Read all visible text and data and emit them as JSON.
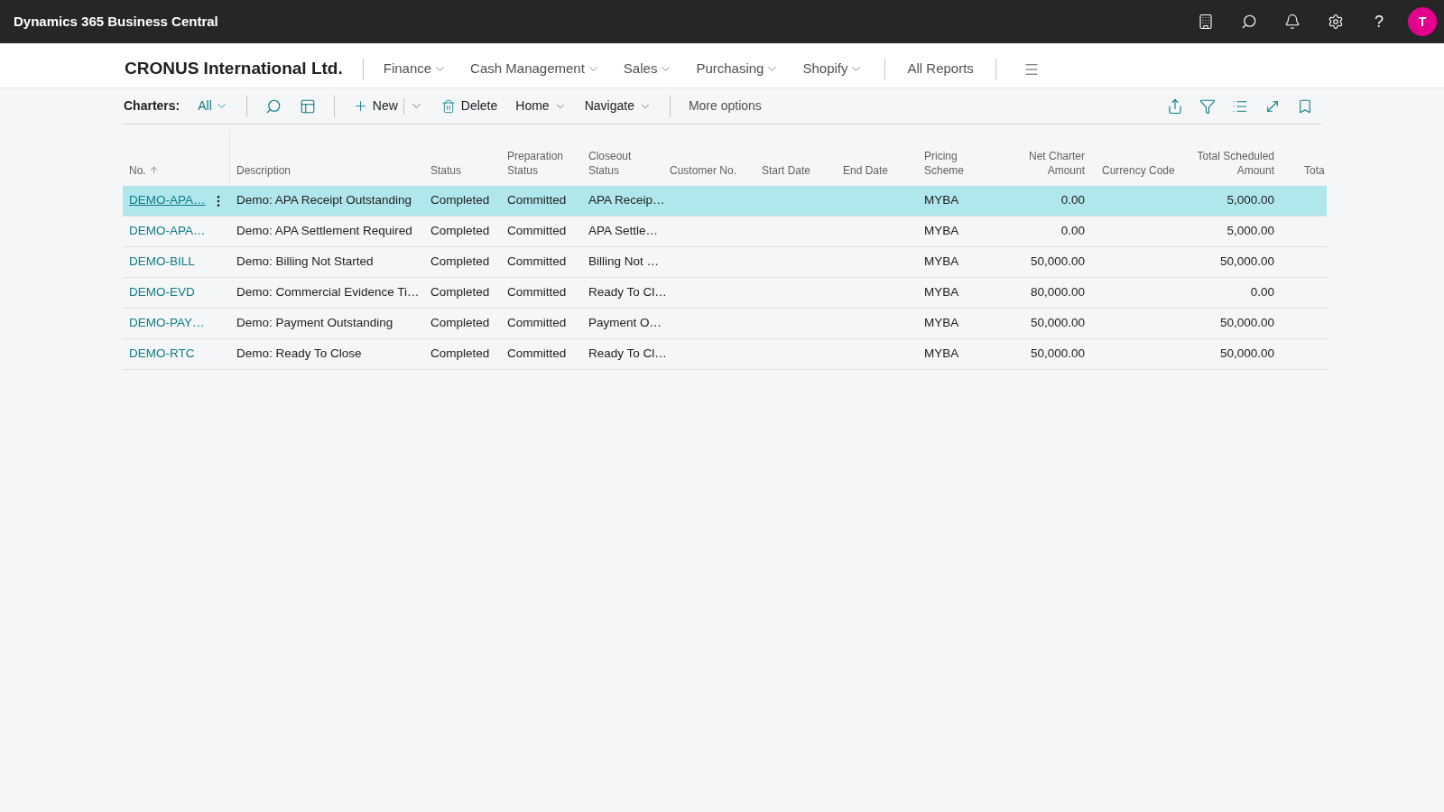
{
  "top_bar": {
    "title": "Dynamics 365 Business Central",
    "help_label": "?",
    "avatar_initial": "T"
  },
  "nav": {
    "company": "CRONUS International Ltd.",
    "menus": [
      {
        "label": "Finance"
      },
      {
        "label": "Cash Management"
      },
      {
        "label": "Sales"
      },
      {
        "label": "Purchasing"
      },
      {
        "label": "Shopify"
      }
    ],
    "reports_link": "All Reports"
  },
  "action_bar": {
    "page_label": "Charters:",
    "view": "All",
    "actions": [
      {
        "kind": "new",
        "label": "New"
      },
      {
        "kind": "delete",
        "label": "Delete"
      },
      {
        "kind": "menu",
        "label": "Home"
      },
      {
        "kind": "menu",
        "label": "Navigate"
      },
      {
        "kind": "more",
        "label": "More options"
      }
    ]
  },
  "table": {
    "columns": [
      {
        "label": "No.",
        "kind": "link",
        "sorted_ascending": true
      },
      {
        "label": "Description",
        "kind": "text",
        "sorted_ascending": false
      },
      {
        "label": "Status",
        "kind": "text",
        "sorted_ascending": false
      },
      {
        "label": "Preparation Status",
        "kind": "text",
        "sorted_ascending": false
      },
      {
        "label": "Closeout Status",
        "kind": "text",
        "sorted_ascending": false
      },
      {
        "label": "Customer No.",
        "kind": "text",
        "sorted_ascending": false
      },
      {
        "label": "Start Date",
        "kind": "text",
        "sorted_ascending": false
      },
      {
        "label": "End Date",
        "kind": "text",
        "sorted_ascending": false
      },
      {
        "label": "Pricing Scheme",
        "kind": "text",
        "sorted_ascending": false
      },
      {
        "label": "Net Charter Amount",
        "kind": "amount",
        "sorted_ascending": false
      },
      {
        "label": "Currency Code",
        "kind": "text",
        "sorted_ascending": false
      },
      {
        "label": "Total Scheduled Amount",
        "kind": "amount",
        "sorted_ascending": false
      },
      {
        "label": "Tota",
        "kind": "text",
        "sorted_ascending": false
      }
    ],
    "rows": [
      {
        "selected": true,
        "no": "DEMO-APA…",
        "description": "Demo: APA Receipt Outstanding",
        "status": "Completed",
        "preparation_status": "Committed",
        "closeout_status": "APA Receip…",
        "pricing_scheme": "MYBA",
        "net_charter_amount": "0.00",
        "total_scheduled_amount": "5,000.00"
      },
      {
        "selected": false,
        "no": "DEMO-APA…",
        "description": "Demo: APA Settlement Required",
        "status": "Completed",
        "preparation_status": "Committed",
        "closeout_status": "APA Settle…",
        "pricing_scheme": "MYBA",
        "net_charter_amount": "0.00",
        "total_scheduled_amount": "5,000.00"
      },
      {
        "selected": false,
        "no": "DEMO-BILL",
        "description": "Demo: Billing Not Started",
        "status": "Completed",
        "preparation_status": "Committed",
        "closeout_status": "Billing Not …",
        "pricing_scheme": "MYBA",
        "net_charter_amount": "50,000.00",
        "total_scheduled_amount": "50,000.00"
      },
      {
        "selected": false,
        "no": "DEMO-EVD",
        "description": "Demo: Commercial Evidence Ti…",
        "status": "Completed",
        "preparation_status": "Committed",
        "closeout_status": "Ready To Cl…",
        "pricing_scheme": "MYBA",
        "net_charter_amount": "80,000.00",
        "total_scheduled_amount": "0.00"
      },
      {
        "selected": false,
        "no": "DEMO-PAY…",
        "description": "Demo: Payment Outstanding",
        "status": "Completed",
        "preparation_status": "Committed",
        "closeout_status": "Payment O…",
        "pricing_scheme": "MYBA",
        "net_charter_amount": "50,000.00",
        "total_scheduled_amount": "50,000.00"
      },
      {
        "selected": false,
        "no": "DEMO-RTC",
        "description": "Demo: Ready To Close",
        "status": "Completed",
        "preparation_status": "Committed",
        "closeout_status": "Ready To Cl…",
        "pricing_scheme": "MYBA",
        "net_charter_amount": "50,000.00",
        "total_scheduled_amount": "50,000.00"
      }
    ]
  }
}
